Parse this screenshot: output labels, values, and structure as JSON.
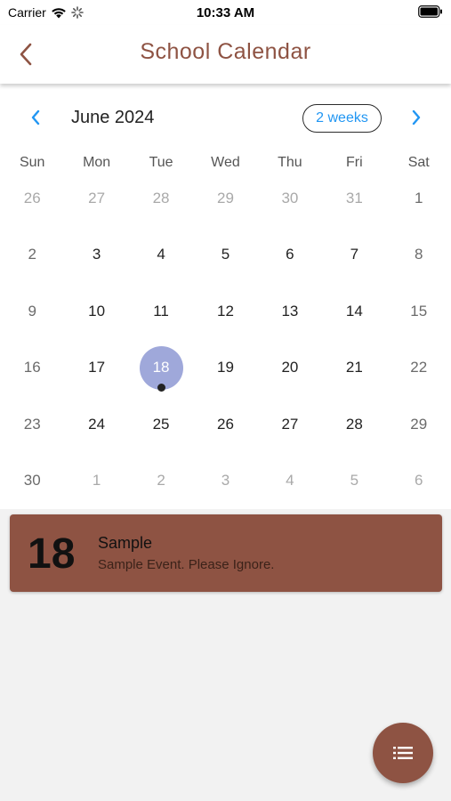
{
  "status_bar": {
    "carrier": "Carrier",
    "time": "10:33 AM"
  },
  "nav": {
    "title": "School Calendar",
    "back_icon": "chevron-left-icon"
  },
  "calendar": {
    "month_label": "June 2024",
    "format_button": "2 weeks",
    "weekdays": [
      "Sun",
      "Mon",
      "Tue",
      "Wed",
      "Thu",
      "Fri",
      "Sat"
    ],
    "weeks": [
      [
        {
          "d": "26",
          "out": true
        },
        {
          "d": "27",
          "out": true
        },
        {
          "d": "28",
          "out": true
        },
        {
          "d": "29",
          "out": true
        },
        {
          "d": "30",
          "out": true
        },
        {
          "d": "31",
          "out": true
        },
        {
          "d": "1"
        }
      ],
      [
        {
          "d": "2"
        },
        {
          "d": "3"
        },
        {
          "d": "4"
        },
        {
          "d": "5"
        },
        {
          "d": "6"
        },
        {
          "d": "7"
        },
        {
          "d": "8"
        }
      ],
      [
        {
          "d": "9"
        },
        {
          "d": "10"
        },
        {
          "d": "11"
        },
        {
          "d": "12"
        },
        {
          "d": "13"
        },
        {
          "d": "14"
        },
        {
          "d": "15"
        }
      ],
      [
        {
          "d": "16"
        },
        {
          "d": "17"
        },
        {
          "d": "18",
          "selected": true,
          "event": true
        },
        {
          "d": "19"
        },
        {
          "d": "20"
        },
        {
          "d": "21"
        },
        {
          "d": "22"
        }
      ],
      [
        {
          "d": "23"
        },
        {
          "d": "24"
        },
        {
          "d": "25"
        },
        {
          "d": "26"
        },
        {
          "d": "27"
        },
        {
          "d": "28"
        },
        {
          "d": "29"
        }
      ],
      [
        {
          "d": "30"
        },
        {
          "d": "1",
          "out": true
        },
        {
          "d": "2",
          "out": true
        },
        {
          "d": "3",
          "out": true
        },
        {
          "d": "4",
          "out": true
        },
        {
          "d": "5",
          "out": true
        },
        {
          "d": "6",
          "out": true
        }
      ]
    ]
  },
  "event": {
    "day": "18",
    "title": "Sample",
    "description": "Sample Event. Please Ignore."
  },
  "fab": {
    "icon": "list-icon"
  },
  "colors": {
    "brand": "#8e5343",
    "selected_day": "#9fa8da",
    "accent": "#2196f3"
  }
}
